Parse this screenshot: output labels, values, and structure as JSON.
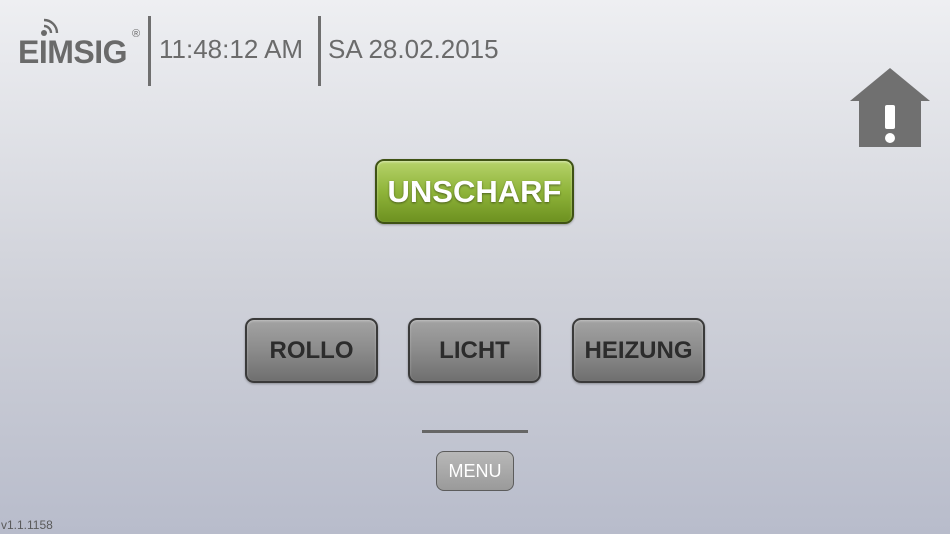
{
  "header": {
    "logo_text": "EIMSIG",
    "logo_reg": "®",
    "time": "11:48:12 AM",
    "date": "SA 28.02.2015"
  },
  "main": {
    "status_button": "UNSCHARF",
    "controls": [
      "ROLLO",
      "LICHT",
      "HEIZUNG"
    ]
  },
  "footer": {
    "menu_label": "MENU",
    "version": "v1.1.1158"
  },
  "icons": {
    "home_alert": "home-alert-icon",
    "logo_signal": "signal-waves-icon"
  },
  "colors": {
    "status_green": "#8fb43a",
    "button_gray": "#8b8b8b",
    "text_gray": "#6b6b6b"
  }
}
